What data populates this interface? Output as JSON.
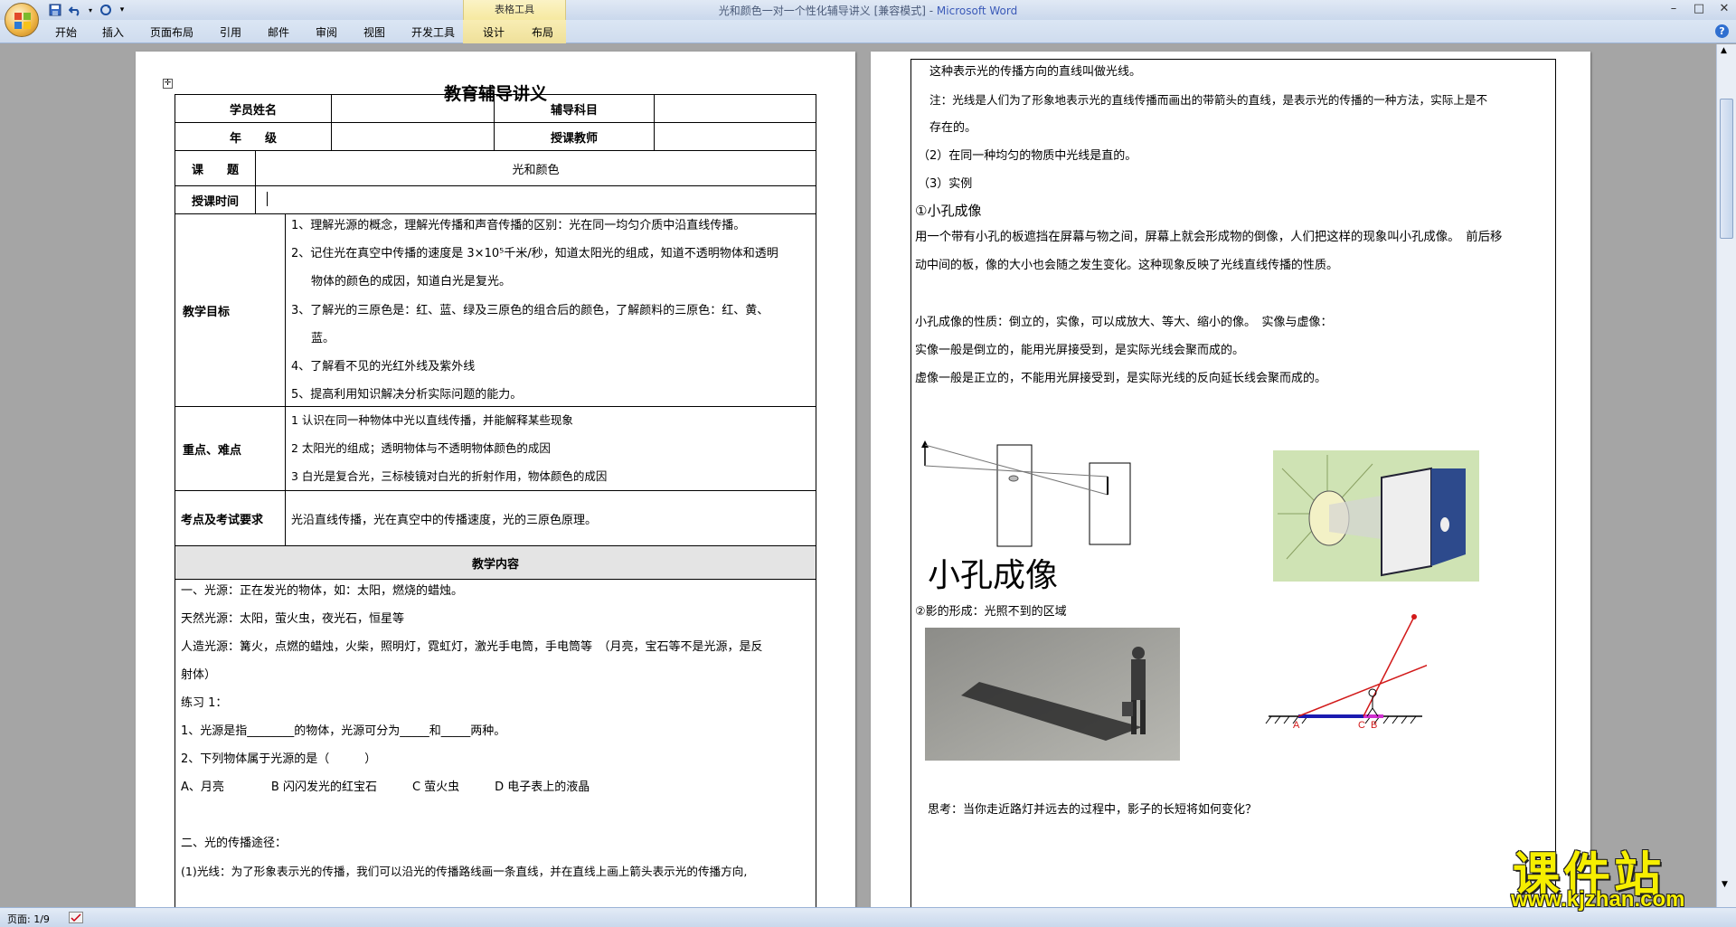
{
  "window": {
    "title": "光和颜色一对一个性化辅导讲义 [兼容模式] - ",
    "app_name": "Microsoft Word",
    "context_group": "表格工具"
  },
  "ribbon": {
    "tabs": [
      "开始",
      "插入",
      "页面布局",
      "引用",
      "邮件",
      "审阅",
      "视图",
      "开发工具",
      "设计",
      "布局"
    ]
  },
  "status": {
    "page": "页面: 1/9"
  },
  "watermark": {
    "cn": "课件站",
    "url": "www.kjzhan.com"
  },
  "page1": {
    "title": "教育辅导讲义",
    "header_rows": {
      "student_label": "学员姓名",
      "subject_label": "辅导科目",
      "grade_label": "年　　级",
      "teacher_label": "授课教师",
      "topic_label": "课　　题",
      "topic_value": "光和颜色",
      "time_label": "授课时间"
    },
    "goals_label": "教学目标",
    "goals": [
      "1、理解光源的概念，理解光传播和声音传播的区别：光在同一均匀介质中沿直线传播。",
      "2、记住光在真空中传播的速度是 3×10⁵千米/秒，知道太阳光的组成，知道不透明物体和透明",
      "物体的颜色的成因，知道白光是复光。",
      "3、了解光的三原色是：红、蓝、绿及三原色的组合后的颜色，了解颜料的三原色：红、黄、",
      "蓝。",
      "4、了解看不见的光红外线及紫外线",
      "5、提高利用知识解决分析实际问题的能力。"
    ],
    "key_label": "重点、难点",
    "keys": [
      "1 认识在同一种物体中光以直线传播，并能解释某些现象",
      "2 太阳光的组成；透明物体与不透明物体颜色的成因",
      "3 白光是复合光，三标棱镜对白光的折射作用，物体颜色的成因"
    ],
    "exam_label": "考点及考试要求",
    "exam_value": "光沿直线传播，光在真空中的传播速度，光的三原色原理。",
    "content_header": "教学内容",
    "content_lines": [
      "一、光源：正在发光的物体，如：太阳，燃烧的蜡烛。",
      "天然光源：太阳，萤火虫，夜光石，恒星等",
      "人造光源：篝火，点燃的蜡烛，火柴，照明灯，霓虹灯，激光手电筒，手电筒等　（月亮，宝石等不是光源，是反",
      "射体）",
      "练习 1：",
      "1、光源是指________的物体，光源可分为_____和_____两种。",
      "2、下列物体属于光源的是（　　　）",
      "A、月亮　　　　B 闪闪发光的红宝石　　　C 萤火虫　　　D 电子表上的液晶",
      "",
      "二、光的传播途径：",
      "(1)光线：为了形象表示光的传播，我们可以沿光的传播路线画一条直线，并在直线上画上箭头表示光的传播方向,"
    ]
  },
  "page2": {
    "lines_top": [
      "这种表示光的传播方向的直线叫做光线。",
      "注：光线是人们为了形象地表示光的直线传播而画出的带箭头的直线，是表示光的传播的一种方法，实际上是不",
      "存在的。",
      "（2）在同一种均匀的物质中光线是直的。",
      "（3）实例"
    ],
    "pinhole_title": "①小孔成像",
    "pinhole_lines": [
      "用一个带有小孔的板遮挡在屏幕与物之间，屏幕上就会形成物的倒像，人们把这样的现象叫小孔成像。　前后移",
      "动中间的板，像的大小也会随之发生变化。这种现象反映了光线直线传播的性质。"
    ],
    "image_lines": [
      "小孔成像的性质：倒立的，实像，可以成放大、等大、缩小的像。　实像与虚像：",
      "实像一般是倒立的，能用光屏接受到，是实际光线会聚而成的。",
      "虚像一般是正立的，不能用光屏接受到，是实际光线的反向延长线会聚而成的。"
    ],
    "fig_caption": "小孔成像",
    "shadow_title": "②影的形成：光照不到的区域",
    "diagram_labels": [
      "A",
      "C",
      "B"
    ],
    "question": "思考：当你走近路灯并远去的过程中，影子的长短将如何变化？"
  }
}
